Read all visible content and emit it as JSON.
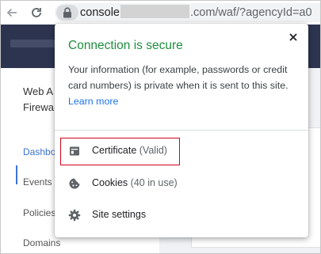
{
  "browser": {
    "url_prefix": "console",
    "url_suffix": ".com/waf/?agencyId=a0"
  },
  "page_behind": {
    "sidebar_title": "Web A\nFirewa",
    "sidebar_items": [
      {
        "label": "Dashbo",
        "active": true
      },
      {
        "label": "Events",
        "active": false
      },
      {
        "label": "Policies",
        "active": false
      },
      {
        "label": "Domains",
        "active": false
      }
    ]
  },
  "popup": {
    "title": "Connection is secure",
    "description": "Your information (for example, passwords or credit card numbers) is private when it is sent to this site.",
    "learn_more": "Learn more",
    "items": [
      {
        "label": "Certificate",
        "detail": "(Valid)",
        "icon": "certificate-icon"
      },
      {
        "label": "Cookies",
        "detail": "(40 in use)",
        "icon": "cookie-icon"
      },
      {
        "label": "Site settings",
        "detail": "",
        "icon": "gear-icon"
      }
    ]
  },
  "colors": {
    "secure_green": "#1e8e3e",
    "link_blue": "#1a73e8",
    "highlight_red": "#d0021b",
    "header_navy": "#2c3450"
  }
}
